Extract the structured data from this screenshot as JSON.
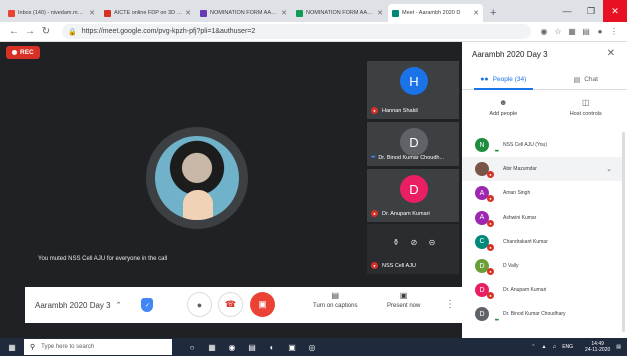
{
  "browser": {
    "tabs": [
      {
        "label": "Inbox (140) - nivedam.m@anl",
        "color": "#ea4335",
        "active": false
      },
      {
        "label": "AICTE online FDP on 3D Print",
        "color": "#d93025",
        "active": false
      },
      {
        "label": "NOMINATION FORM AARAMBH",
        "color": "#673ab7",
        "active": false
      },
      {
        "label": "NOMINATION FORM AARAMBH",
        "color": "#0f9d58",
        "active": false
      },
      {
        "label": "Meet - Aarambh 2020 D",
        "color": "#00897b",
        "active": true
      }
    ],
    "new_tab": "+",
    "url": "https://meet.google.com/pvg-kpzh-pfj?pli=1&authuser=2"
  },
  "meet": {
    "rec_label": "REC",
    "toast": "You muted NSS Cell AJU for everyone in the call",
    "tiles": [
      {
        "initial": "H",
        "name": "Hannan Shakil",
        "color": "#1a73e8",
        "muted": true
      },
      {
        "initial": "D",
        "name": "Dr. Binod Kumar Choudh...",
        "color": "#5f6368",
        "muted": false
      },
      {
        "initial": "D",
        "name": "Dr. Anupam Kumari",
        "color": "#e91e63",
        "muted": true
      },
      {
        "initial": "",
        "name": "NSS Cell AJU",
        "color": "#3c4043",
        "muted": true
      }
    ],
    "toolbar": {
      "meeting_name": "Aarambh 2020 Day 3",
      "captions_label": "Turn on captions",
      "present_label": "Present now"
    }
  },
  "panel": {
    "title": "Aarambh 2020 Day 3",
    "tab_people": "People (34)",
    "tab_chat": "Chat",
    "add_people": "Add people",
    "host_controls": "Host controls",
    "participants": [
      {
        "initial": "N",
        "name": "NSS Cell AJU (You)",
        "color": "#1e8e3e",
        "badge": "dots"
      },
      {
        "initial": "",
        "name": "Abir Mazumdar",
        "color": "#795548",
        "badge": "muted",
        "expand": true
      },
      {
        "initial": "A",
        "name": "Aman Singh",
        "color": "#9c27b0",
        "badge": "muted"
      },
      {
        "initial": "A",
        "name": "Ashwini Kumar",
        "color": "#9c27b0",
        "badge": "muted"
      },
      {
        "initial": "C",
        "name": "Chandrakant Kumar",
        "color": "#00897b",
        "badge": "muted"
      },
      {
        "initial": "D",
        "name": "D Vally",
        "color": "#689f38",
        "badge": "muted"
      },
      {
        "initial": "D",
        "name": "Dr. Anupam Kumari",
        "color": "#e91e63",
        "badge": "muted"
      },
      {
        "initial": "D",
        "name": "Dr. Binod Kumar Choudhary",
        "color": "#5f6368",
        "badge": "dots"
      }
    ]
  },
  "taskbar": {
    "search_placeholder": "Type here to search",
    "lang": "ENG",
    "time": "14:49",
    "date": "24-11-2020"
  }
}
